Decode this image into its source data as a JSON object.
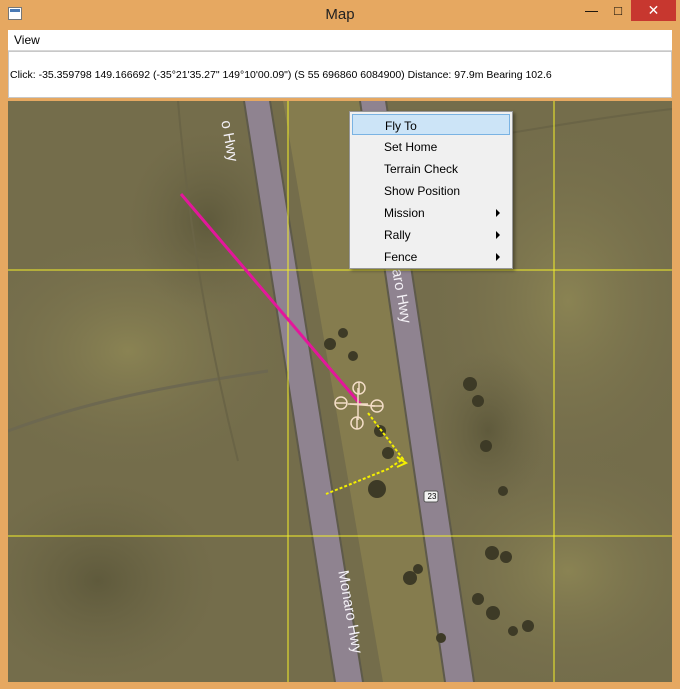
{
  "window": {
    "title": "Map",
    "min_glyph": "—",
    "max_glyph": "□",
    "close_glyph": "✕",
    "icon": "map-window-icon"
  },
  "menubar": {
    "view_label": "View"
  },
  "status": {
    "text": "Click: -35.359798 149.166692 (-35°21'35.27\" 149°10'00.09\") (S 55 696860 6084900)  Distance: 97.9m Bearing 102.6"
  },
  "map": {
    "road_labels": [
      "o Hwy",
      "onaro Hwy",
      "Monaro Hwy"
    ],
    "road_shield": "23",
    "colors": {
      "flight_line": "#e3179b",
      "grid": "#f3ef2a",
      "mission_path": "#f5f000"
    }
  },
  "context_menu": {
    "items": [
      {
        "label": "Fly To",
        "submenu": false,
        "highlighted": true
      },
      {
        "label": "Set Home",
        "submenu": false,
        "highlighted": false
      },
      {
        "label": "Terrain Check",
        "submenu": false,
        "highlighted": false
      },
      {
        "label": "Show Position",
        "submenu": false,
        "highlighted": false
      },
      {
        "label": "Mission",
        "submenu": true,
        "highlighted": false
      },
      {
        "label": "Rally",
        "submenu": true,
        "highlighted": false
      },
      {
        "label": "Fence",
        "submenu": true,
        "highlighted": false
      }
    ]
  }
}
